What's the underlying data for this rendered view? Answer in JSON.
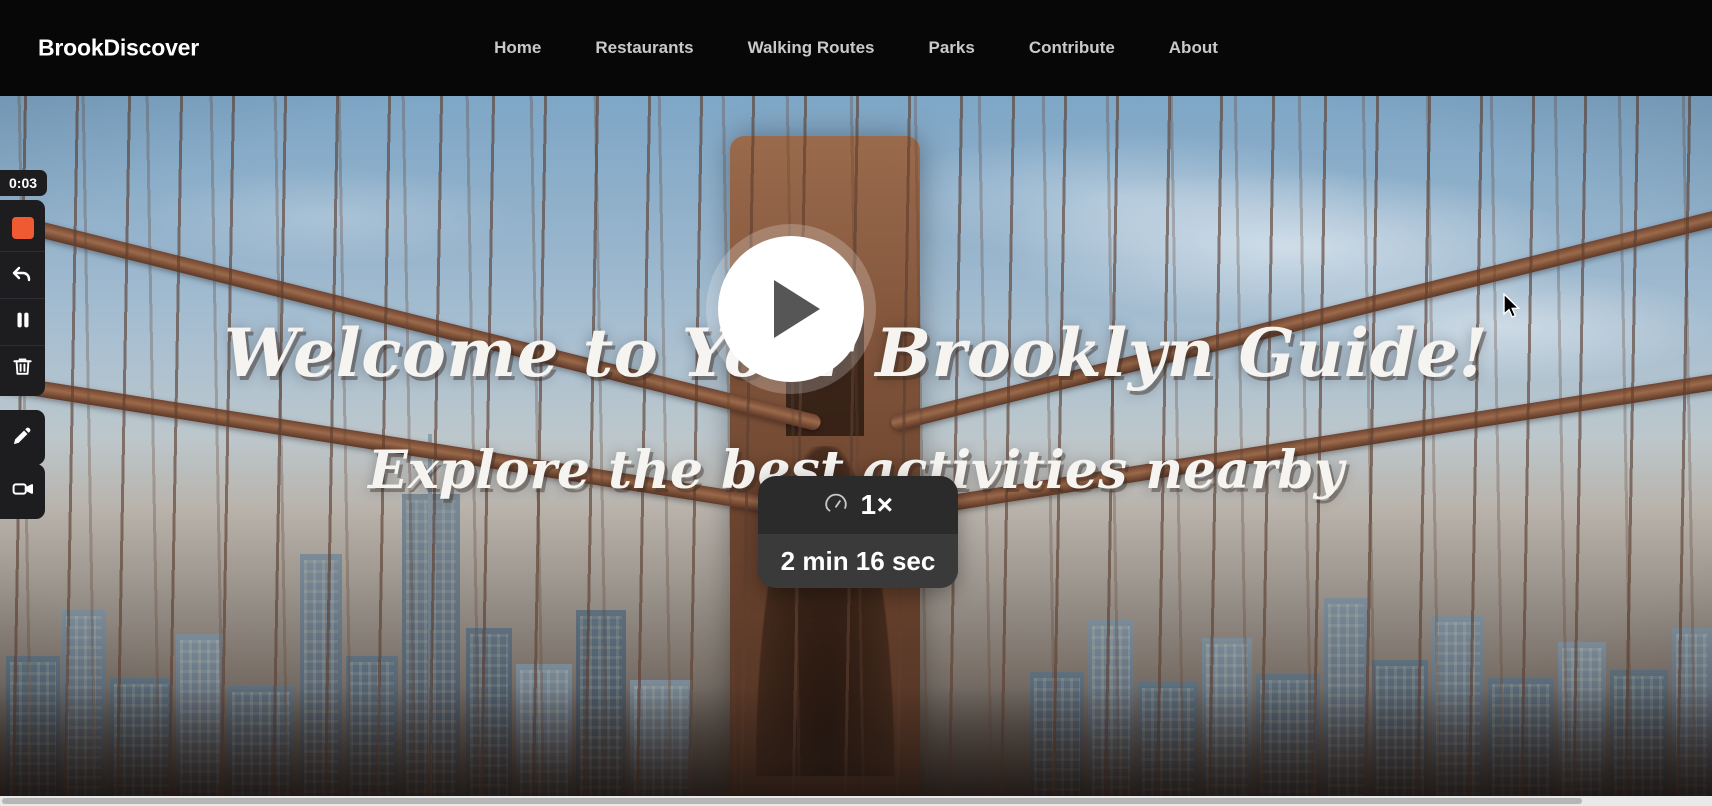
{
  "site": {
    "brand": "BrookDiscover",
    "nav": [
      {
        "label": "Home",
        "name": "nav-home"
      },
      {
        "label": "Restaurants",
        "name": "nav-restaurants"
      },
      {
        "label": "Walking Routes",
        "name": "nav-walking-routes"
      },
      {
        "label": "Parks",
        "name": "nav-parks"
      },
      {
        "label": "Contribute",
        "name": "nav-contribute"
      },
      {
        "label": "About",
        "name": "nav-about"
      }
    ]
  },
  "hero": {
    "title": "Welcome to Your Brooklyn Guide!",
    "subtitle": "Explore the best activities nearby",
    "image_alt": "brooklyn-bridge-photo"
  },
  "video": {
    "play_icon": "play-triangle-icon",
    "speed_icon": "speedometer-icon",
    "speed": "1×",
    "duration": "2 min 16 sec"
  },
  "recorder": {
    "timer": "0:03",
    "controls": [
      {
        "name": "stop-recording-button",
        "icon": "stop-square-icon"
      },
      {
        "name": "undo-button",
        "icon": "undo-arrow-icon"
      },
      {
        "name": "pause-recording-button",
        "icon": "pause-icon"
      },
      {
        "name": "delete-recording-button",
        "icon": "trash-icon"
      },
      {
        "name": "annotate-button",
        "icon": "pen-icon"
      },
      {
        "name": "camera-button",
        "icon": "video-camera-icon"
      }
    ]
  },
  "colors": {
    "nav_background": "#070707",
    "nav_link": "#c9c9c9",
    "brand_text": "#ffffff",
    "stop_button": "#f05a32",
    "toolbar_background": "#1d1d20",
    "overlay_background": "#2b2b2b",
    "overlay_duration_background": "#3a3a3a",
    "play_button": "#ffffff",
    "play_triangle": "#565656"
  }
}
